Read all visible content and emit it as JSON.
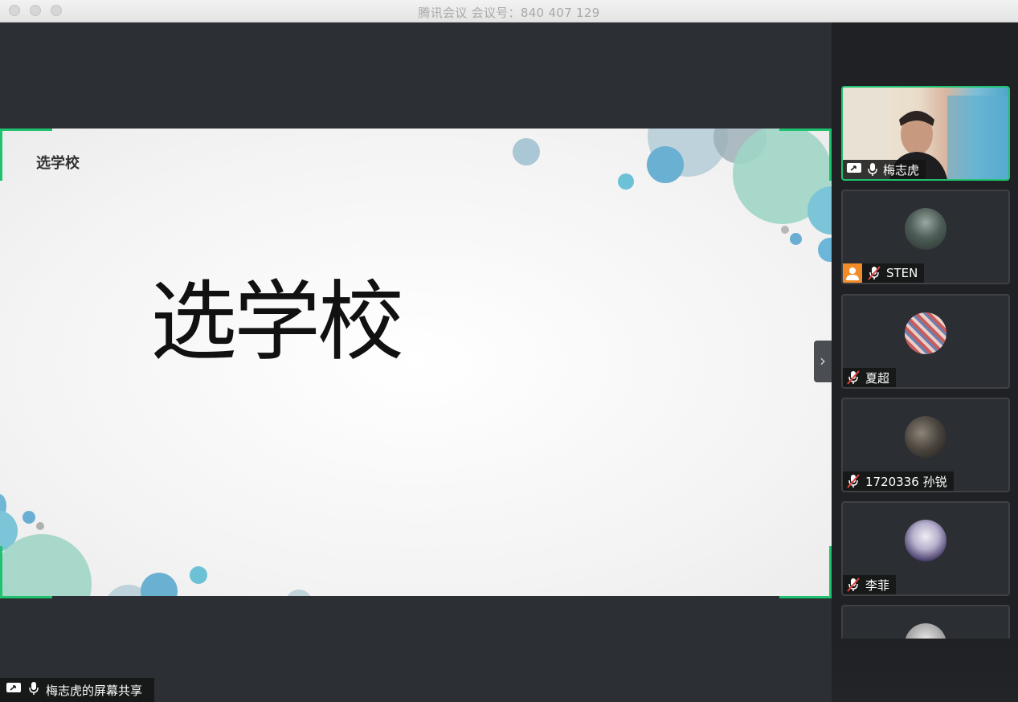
{
  "window": {
    "title": "腾讯会议 会议号：840 407 129"
  },
  "slide": {
    "small_title": "选学校",
    "big_title": "选学校"
  },
  "share_label": {
    "text": "梅志虎的屏幕共享"
  },
  "participants": [
    {
      "name": "梅志虎",
      "active": true,
      "video_on": true,
      "mic": "on",
      "sharing": true
    },
    {
      "name": "STEN",
      "mic": "muted",
      "role_icon": "user-icon"
    },
    {
      "name": "夏超",
      "mic": "muted"
    },
    {
      "name": "1720336 孙锐",
      "mic": "muted"
    },
    {
      "name": "李菲",
      "mic": "muted"
    },
    {
      "name": "",
      "mic": "muted"
    }
  ],
  "colors": {
    "accent": "#1fc26f",
    "role_badge": "#f28c28"
  }
}
